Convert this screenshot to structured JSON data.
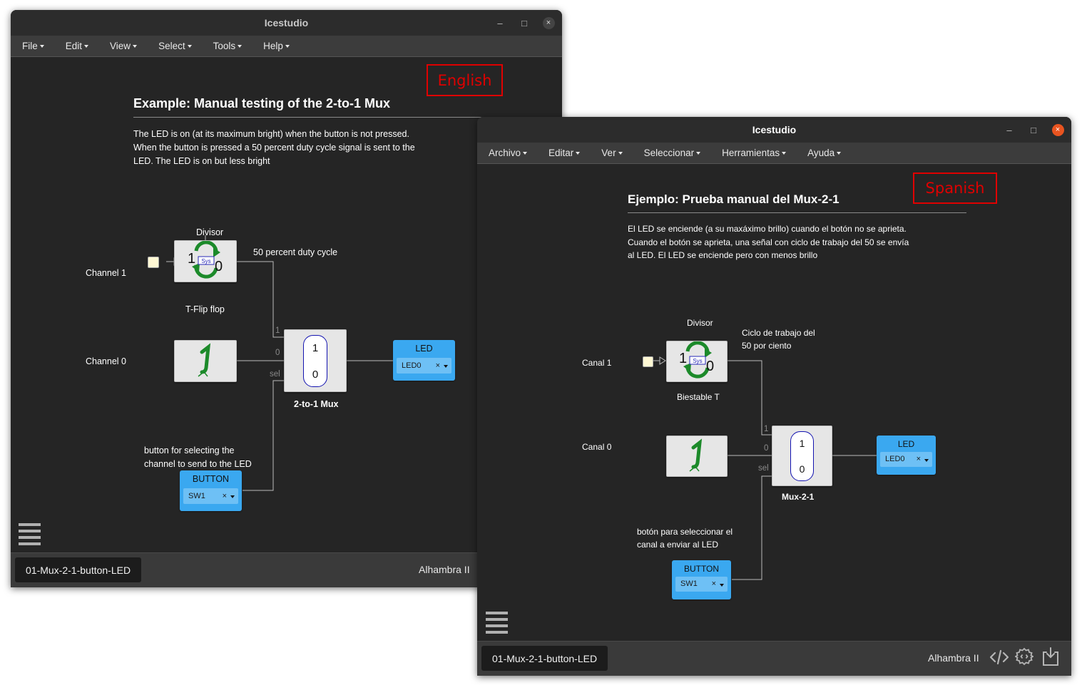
{
  "en": {
    "title": "Icestudio",
    "menu": [
      {
        "label": "File"
      },
      {
        "label": "Edit"
      },
      {
        "label": "View"
      },
      {
        "label": "Select"
      },
      {
        "label": "Tools"
      },
      {
        "label": "Help"
      }
    ],
    "language_tag": "English",
    "heading": "Example: Manual testing of the 2-to-1 Mux",
    "description": [
      "The LED is on (at its maximum bright) when the button is not pressed.",
      "When the button is pressed a 50 percent duty cycle signal is sent to the",
      "LED. The LED is on but less bright"
    ],
    "divisor_label": "Divisor",
    "duty_note": "50 percent duty cycle",
    "channel1": "Channel 1",
    "channel0": "Channel 0",
    "tflip_label": "T-Flip flop",
    "mux_label": "2-to-1 Mux",
    "mux_in1": "1",
    "mux_in0": "0",
    "mux_sel": "sel",
    "button_note": [
      "button for selecting the",
      "channel to send to the LED"
    ],
    "button_port": {
      "title": "BUTTON",
      "value": "SW1"
    },
    "led_port": {
      "title": "LED",
      "value": "LED0"
    },
    "file_tab": "01-Mux-2-1-button-LED",
    "board": "Alhambra II"
  },
  "es": {
    "title": "Icestudio",
    "menu": [
      {
        "label": "Archivo"
      },
      {
        "label": "Editar"
      },
      {
        "label": "Ver"
      },
      {
        "label": "Seleccionar"
      },
      {
        "label": "Herramientas"
      },
      {
        "label": "Ayuda"
      }
    ],
    "language_tag": "Spanish",
    "heading": "Ejemplo: Prueba manual del Mux-2-1",
    "description": [
      "El LED se enciende (a su maxáximo brillo) cuando el botón no se aprieta.",
      "Cuando el botón se aprieta, una señal con ciclo de trabajo del 50 se envía",
      "al LED. El LED se enciende pero con menos brillo"
    ],
    "divisor_label": "Divisor",
    "duty_note": [
      "Ciclo de trabajo del",
      "50 por ciento"
    ],
    "channel1": "Canal 1",
    "channel0": "Canal 0",
    "tflip_label": "Biestable T",
    "mux_label": "Mux-2-1",
    "mux_in1": "1",
    "mux_in0": "0",
    "mux_sel": "sel",
    "button_note": [
      "botón para seleccionar el",
      "canal a enviar al LED"
    ],
    "button_port": {
      "title": "BUTTON",
      "value": "SW1"
    },
    "led_port": {
      "title": "LED",
      "value": "LED0"
    },
    "file_tab": "01-Mux-2-1-button-LED",
    "board": "Alhambra II"
  },
  "common": {
    "window_controls": {
      "minimize": "–",
      "maximize": "□",
      "close": "×"
    },
    "tflip_digits": {
      "left": "1",
      "right": "0",
      "badge": "Sys"
    },
    "clear_symbol": "×",
    "colors": {
      "canvas_bg": "#252525",
      "port_blue": "#3aa8f0",
      "wire": "#bbbbbb",
      "flipflop_green": "#1c8a2a",
      "close_button_active": "#e95420",
      "language_box": "#e00000"
    },
    "icons": [
      "tflipflop-icon",
      "button-finger-icon",
      "hamburger-menu-icon",
      "code-view-icon",
      "settings-gear-icon",
      "upload-icon"
    ]
  }
}
